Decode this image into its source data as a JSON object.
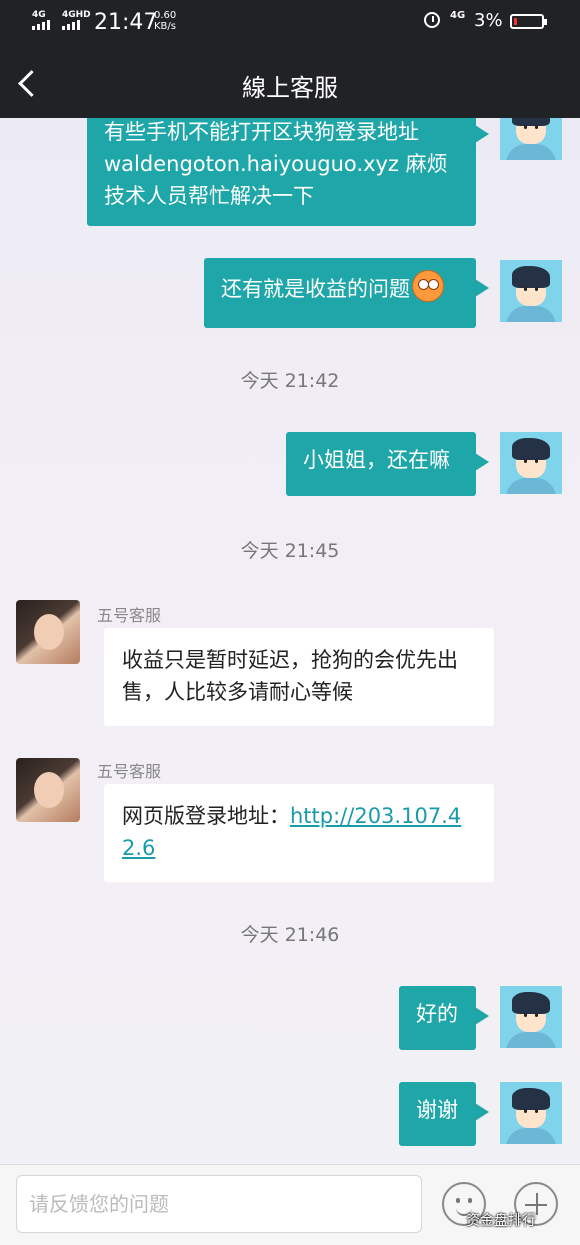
{
  "status_bar": {
    "network_1": "4G",
    "network_2": "4GHD",
    "time": "21:47",
    "speed_value": "0.60",
    "speed_unit": "KB/s",
    "network_right": "4G",
    "battery": "3%"
  },
  "header": {
    "title": "線上客服",
    "back_icon": "chevron-left-icon"
  },
  "messages": [
    {
      "sender": "me",
      "text": "有些手机不能打开区块狗登录地址waldengoton.haiyouguo.xyz 麻烦技术人员帮忙解决一下"
    },
    {
      "sender": "me",
      "text": "还有就是收益的问题",
      "emoji": "flushed-face-emoji"
    },
    {
      "timestamp": "今天 21:42"
    },
    {
      "sender": "me",
      "text": "小姐姐，还在嘛"
    },
    {
      "timestamp": "今天 21:45"
    },
    {
      "sender": "agent",
      "name": "五号客服",
      "text": "收益只是暂时延迟，抢狗的会优先出售，人比较多请耐心等候"
    },
    {
      "sender": "agent",
      "name": "五号客服",
      "text_prefix": "网页版登录地址：",
      "link": "http://203.107.42.6"
    },
    {
      "timestamp": "今天 21:46"
    },
    {
      "sender": "me",
      "text": "好的"
    },
    {
      "sender": "me",
      "text": "谢谢"
    }
  ],
  "input": {
    "placeholder": "请反馈您的问题"
  },
  "watermark": "资金盘排行",
  "colors": {
    "my_bubble": "#1fa6a8",
    "header_bg": "#202225",
    "link": "#1a9bab"
  }
}
